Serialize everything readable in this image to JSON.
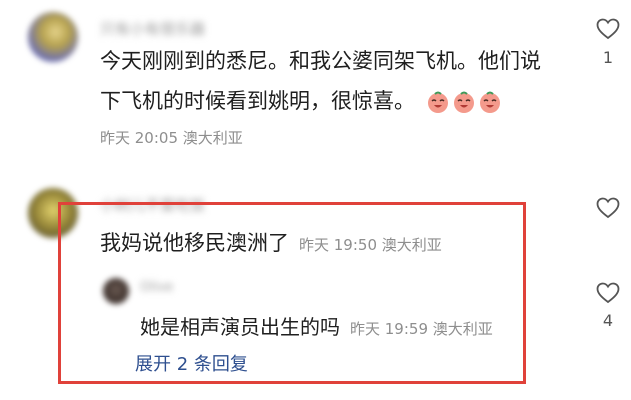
{
  "comments": [
    {
      "username": "只有小有很乐器",
      "text_line1": "今天刚刚到的悉尼。和我公婆同架飞机。他们说",
      "text_line2": "下飞机的时候看到姚明，很惊喜。",
      "emoji": "peach-laugh-emoji",
      "meta": "昨天 20:05 澳大利亚",
      "like_count": "1"
    },
    {
      "username": "小树儿不爱吃饭",
      "text": "我妈说他移民澳洲了",
      "meta": "昨天 19:50 澳大利亚",
      "like_count": ""
    }
  ],
  "reply": {
    "username": "Olive",
    "text": "她是相声演员出生的吗",
    "meta": "昨天 19:59 澳大利亚",
    "like_count": "4"
  },
  "expand_replies": "展开 2 条回复",
  "colors": {
    "highlight": "#e0413a",
    "link": "#2e4f8f",
    "meta": "#8e8e8e"
  }
}
